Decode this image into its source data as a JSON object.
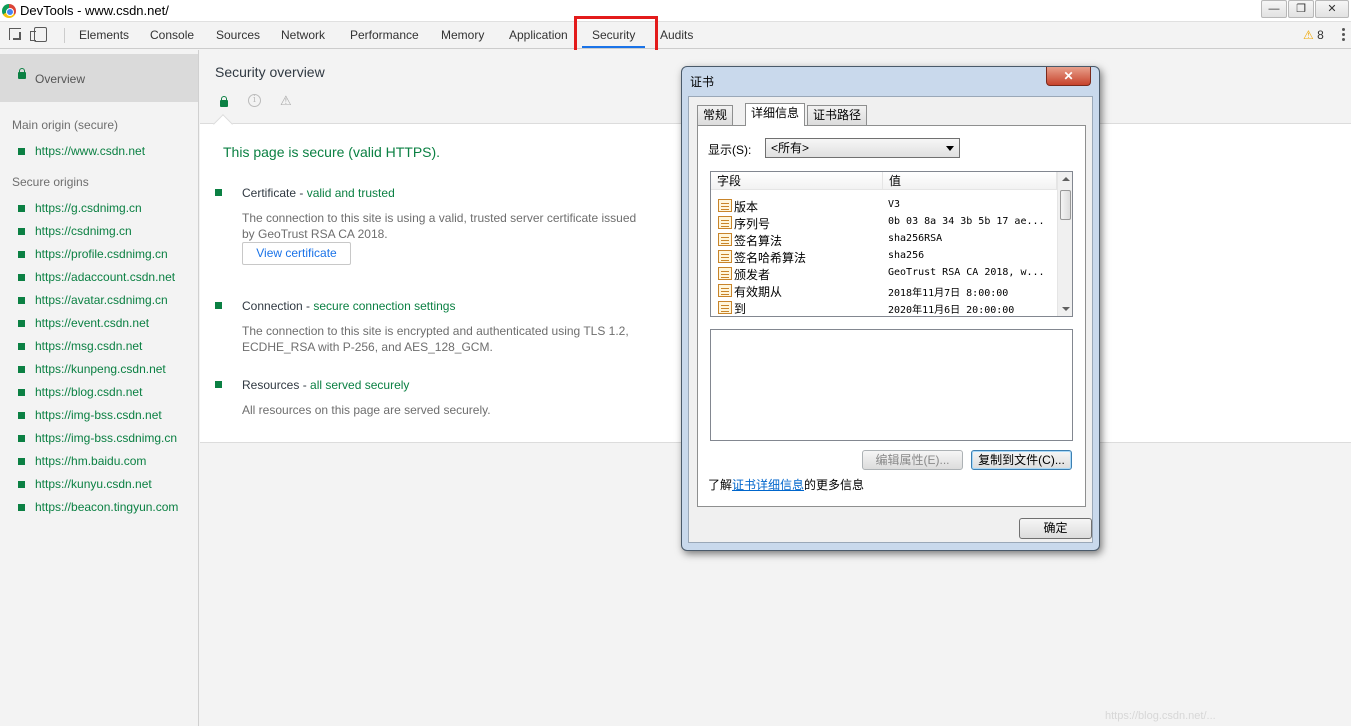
{
  "window": {
    "title": "DevTools - www.csdn.net/",
    "controls": {
      "minimize": "—",
      "restore": "❐",
      "close": "✕"
    }
  },
  "toolbar": {
    "tabs": [
      {
        "label": "Elements"
      },
      {
        "label": "Console"
      },
      {
        "label": "Sources"
      },
      {
        "label": "Network"
      },
      {
        "label": "Performance"
      },
      {
        "label": "Memory"
      },
      {
        "label": "Application"
      },
      {
        "label": "Security",
        "active": true
      },
      {
        "label": "Audits"
      }
    ],
    "warning_count": "8",
    "warning_glyph": "⚠",
    "highlight_color": "#e31b1b",
    "active_tab_color": "#1a73e8"
  },
  "sidebar": {
    "overview_label": "Overview",
    "main_origin_heading": "Main origin (secure)",
    "main_origin": "https://www.csdn.net",
    "secure_origins_heading": "Secure origins",
    "secure_origins": [
      "https://g.csdnimg.cn",
      "https://csdnimg.cn",
      "https://profile.csdnimg.cn",
      "https://adaccount.csdn.net",
      "https://avatar.csdnimg.cn",
      "https://event.csdn.net",
      "https://msg.csdn.net",
      "https://kunpeng.csdn.net",
      "https://blog.csdn.net",
      "https://img-bss.csdn.net",
      "https://img-bss.csdnimg.cn",
      "https://hm.baidu.com",
      "https://kunyu.csdn.net",
      "https://beacon.tingyun.com"
    ],
    "secure_color": "#0b8043"
  },
  "main": {
    "title": "Security overview",
    "header_icons": [
      "lock-icon",
      "info-icon",
      "warning-icon"
    ],
    "info_glyph": "i",
    "warning_glyph": "⚠",
    "summary": "This page is secure (valid HTTPS).",
    "certificate": {
      "title": "Certificate - ",
      "status": "valid and trusted",
      "description": "The connection to this site is using a valid, trusted server certificate issued by GeoTrust RSA CA 2018.",
      "button_label": "View certificate"
    },
    "connection": {
      "title": "Connection - ",
      "status": "secure connection settings",
      "description": "The connection to this site is encrypted and authenticated using TLS 1.2, ECDHE_RSA with P-256, and AES_128_GCM."
    },
    "resources": {
      "title": "Resources - ",
      "status": "all served securely",
      "description": "All resources on this page are served securely."
    }
  },
  "cert_dialog": {
    "title": "证书",
    "close_glyph": "✕",
    "tabs": [
      {
        "label": "常规"
      },
      {
        "label": "详细信息",
        "active": true
      },
      {
        "label": "证书路径"
      }
    ],
    "show_label": "显示(S):",
    "show_value": "<所有>",
    "columns": {
      "field": "字段",
      "value": "值"
    },
    "rows": [
      {
        "field": "版本",
        "value": "V3"
      },
      {
        "field": "序列号",
        "value": "0b 03 8a 34 3b 5b 17 ae..."
      },
      {
        "field": "签名算法",
        "value": "sha256RSA"
      },
      {
        "field": "签名哈希算法",
        "value": "sha256"
      },
      {
        "field": "颁发者",
        "value": "GeoTrust RSA CA 2018, w..."
      },
      {
        "field": "有效期从",
        "value": "2018年11月7日 8:00:00"
      },
      {
        "field": "到",
        "value": "2020年11月6日 20:00:00"
      }
    ],
    "edit_properties_label": "编辑属性(E)...",
    "copy_to_file_label": "复制到文件(C)...",
    "learn_more_prefix": "了解",
    "learn_more_link": "证书详细信息",
    "learn_more_suffix": "的更多信息",
    "ok_label": "确定"
  },
  "watermark": "https://blog.csdn.net/..."
}
